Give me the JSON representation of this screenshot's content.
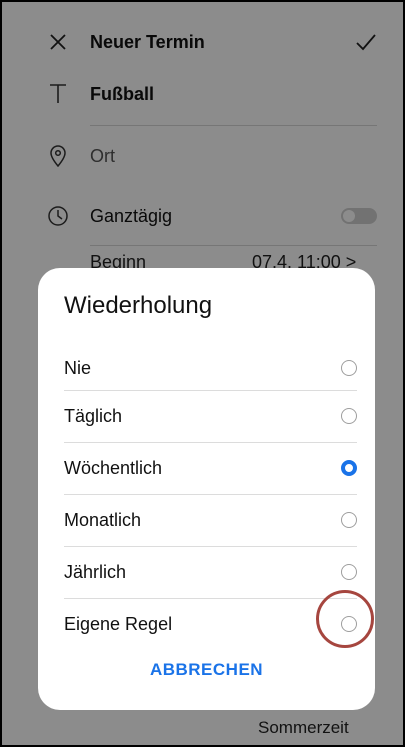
{
  "colors": {
    "accent": "#1a73e8",
    "highlight_ring": "#a6463f"
  },
  "header": {
    "title": "Neuer Termin",
    "close_icon": "close-icon",
    "confirm_icon": "check-icon"
  },
  "fields": {
    "title_value": "Fußball",
    "location_placeholder": "Ort",
    "all_day_label": "Ganztägig",
    "all_day_on": false,
    "begin_label_partial": "Beginn",
    "begin_value_partial": "07.4. 11:00 >",
    "footer_partial": "Sommerzeit"
  },
  "dialog": {
    "title": "Wiederholung",
    "options": [
      {
        "label": "Nie",
        "selected": false
      },
      {
        "label": "Täglich",
        "selected": false
      },
      {
        "label": "Wöchentlich",
        "selected": true
      },
      {
        "label": "Monatlich",
        "selected": false
      },
      {
        "label": "Jährlich",
        "selected": false
      },
      {
        "label": "Eigene Regel",
        "selected": false
      }
    ],
    "cancel_label": "ABBRECHEN"
  }
}
